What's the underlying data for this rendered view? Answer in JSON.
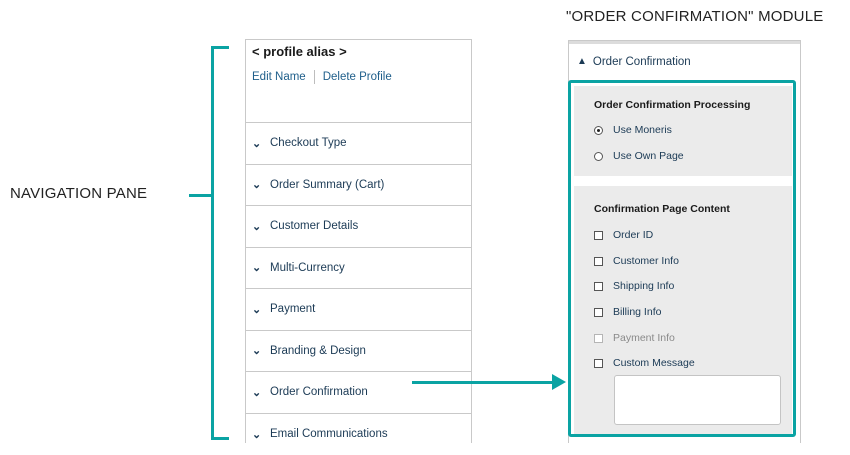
{
  "annotations": {
    "module_title": "\"ORDER CONFIRMATION\" MODULE",
    "nav_pane_label": "NAVIGATION PANE",
    "accent_color": "#0aa3a3"
  },
  "nav": {
    "alias": "< profile alias >",
    "edit_name": "Edit Name",
    "delete_profile": "Delete Profile",
    "items": [
      {
        "label": "Checkout Type"
      },
      {
        "label": "Order Summary (Cart)"
      },
      {
        "label": "Customer Details"
      },
      {
        "label": "Multi-Currency"
      },
      {
        "label": "Payment"
      },
      {
        "label": "Branding & Design"
      },
      {
        "label": "Order Confirmation"
      },
      {
        "label": "Email Communications"
      }
    ],
    "chevron_icon": "chevron-down-icon"
  },
  "module": {
    "header": "Order Confirmation",
    "chevron_icon": "chevron-up-icon",
    "processing": {
      "title": "Order Confirmation Processing",
      "options": [
        {
          "label": "Use Moneris",
          "selected": true
        },
        {
          "label": "Use Own Page",
          "selected": false
        }
      ]
    },
    "content": {
      "title": "Confirmation Page Content",
      "options": [
        {
          "label": "Order ID",
          "checked": false,
          "disabled": false
        },
        {
          "label": "Customer Info",
          "checked": false,
          "disabled": false
        },
        {
          "label": "Shipping Info",
          "checked": false,
          "disabled": false
        },
        {
          "label": "Billing Info",
          "checked": false,
          "disabled": false
        },
        {
          "label": "Payment Info",
          "checked": false,
          "disabled": true
        },
        {
          "label": "Custom Message",
          "checked": false,
          "disabled": false
        }
      ],
      "custom_message_value": ""
    }
  }
}
